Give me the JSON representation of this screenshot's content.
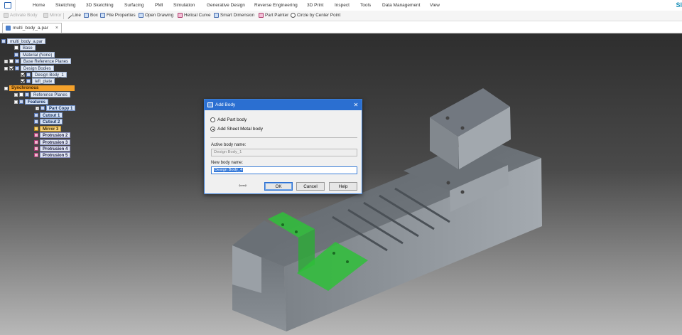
{
  "menubar": {
    "items": [
      "Home",
      "Sketching",
      "3D Sketching",
      "Surfacing",
      "PMI",
      "Simulation",
      "Generative Design",
      "Reverse Engineering",
      "3D Print",
      "Inspect",
      "Tools",
      "Data Management",
      "View"
    ],
    "brand": "SI"
  },
  "commands": {
    "activate_body": "Activate Body",
    "mirror": "Mirror",
    "line": "Line",
    "box": "Box",
    "file_properties": "File Properties",
    "open_drawing": "Open Drawing",
    "helical_curve": "Helical Curve",
    "smart_dimension": "Smart Dimension",
    "part_painter": "Part Painter",
    "circle_center": "Circle by Center Point"
  },
  "document_tab": {
    "label": "multi_body_a.par",
    "close": "×"
  },
  "tree": {
    "root": "multi_body_a.par",
    "base": "Base",
    "material": "Material (None)",
    "base_ref_planes": "Base Reference Planes",
    "design_bodies": "Design Bodies",
    "design_body_1": "Design Body_1",
    "left_plate": "left_plate",
    "synchronous": "Synchronous",
    "reference_planes": "Reference Planes",
    "features": "Features",
    "part_copy": "Part Copy 1",
    "cutout_1": "Cutout 1",
    "cutout_2": "Cutout 2",
    "mirror_3": "Mirror 3",
    "protrusion_2": "Protrusion 2",
    "protrusion_3": "Protrusion 3",
    "protrusion_4": "Protrusion 4",
    "protrusion_5": "Protrusion 5"
  },
  "dialog": {
    "title": "Add Body",
    "close": "✕",
    "option_part": "Add Part body",
    "option_sheet": "Add Sheet Metal body",
    "selected_option": "sheet_metal",
    "active_label": "Active body name:",
    "active_value": "Design Body_1",
    "new_label": "New body name:",
    "new_value": "Design Body_4",
    "ok": "OK",
    "cancel": "Cancel",
    "help": "Help"
  },
  "colors": {
    "accent": "#2b6fd1",
    "synchronous": "#f4a12b",
    "highlight_body": "#2fbf3a",
    "model_steel": "#8a9096"
  }
}
